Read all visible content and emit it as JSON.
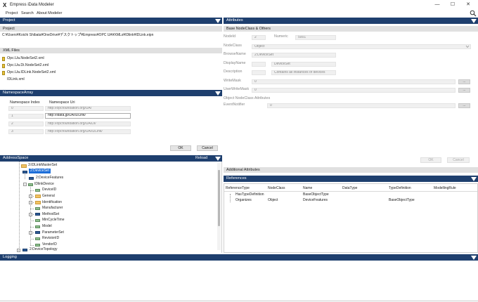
{
  "window": {
    "title": "Empress iData Modeler",
    "logo": "X",
    "controls": {
      "minimize": "—",
      "maximize": "☐",
      "close": "✕"
    }
  },
  "menu": {
    "items": [
      "Project",
      "Search",
      "About Modeler"
    ]
  },
  "project": {
    "header": "Project",
    "subheader": "Project",
    "path": "C:¥Users¥Koichi Shibata¥OneDrive¥デスクトップ¥Empress¥OPC UA¥XMLs¥IDlink¥IDLink.eipn"
  },
  "xml_files": {
    "header": "XML Files",
    "items": [
      "Opc.Ua.NodeSet2.xml",
      "Opc.Ua.Di.NodeSet2.xml",
      "Opc.Ua.IDLink.NodeSet2.xml",
      "IDLink.xml"
    ]
  },
  "namespace": {
    "header": "NamespaceArray",
    "col_index": "Namespace Index",
    "col_uri": "Namespace Uri",
    "rows": [
      {
        "index": "0",
        "uri": "http://opcfoundation.org/UA/"
      },
      {
        "index": "1",
        "uri": "http://idata.jp/UA/IDLink/"
      },
      {
        "index": "2",
        "uri": "http://opcfoundation.org/UA/DI/"
      },
      {
        "index": "3",
        "uri": "http://opcfoundation.org/UA/IDLink/"
      }
    ],
    "ok": "OK",
    "cancel": "Cancel"
  },
  "address_space": {
    "header": "AddressSpace",
    "reload": "Reload",
    "nodes": {
      "idlink_masterset": "3:IDLinkMasterSet",
      "devicenet": "2:DeviceSet",
      "device_features": "2:DeviceFeatures",
      "idlink_device": "IDlinkDevice",
      "device_id": "DeviceID",
      "general": "General",
      "identification": "Identification",
      "manufacturer": "Manufacturer",
      "method_set": "MethodSet",
      "min_cycle_time": "MinCycleTime",
      "model": "Model",
      "parameter_set": "ParameterSet",
      "revision_id": "RevisionID",
      "vendor_id": "VendorID",
      "device_topology": "2:DeviceTopology"
    }
  },
  "attributes": {
    "header": "Attributes",
    "subheader": "Base NodeClass & Others",
    "nodeid_label": "NodeId",
    "nodeid_ns": "2",
    "nodeid_type": "Numeric",
    "nodeid_value": "5001",
    "nodeclass_label": "NodeClass",
    "nodeclass_value": "Object",
    "browsename_label": "BrowseName",
    "browsename_value": "2:DeviceSet",
    "displayname_label": "DisplayName",
    "displayname_value": "DeviceSet",
    "description_label": "Description",
    "description_value": "Contains all instances of devices",
    "writemask_label": "WriteMask",
    "writemask_value": "0",
    "userwritemask_label": "UserWriteMask",
    "userwritemask_value": "0",
    "object_attrs_label": "Object NodeClass Attributes",
    "eventnotifier_label": "EventNotifier",
    "eventnotifier_value": "0",
    "ellipsis": "...",
    "ok": "OK",
    "cancel": "Cancel"
  },
  "additional_attributes": {
    "header": "Additional Attributes"
  },
  "references": {
    "header": "References",
    "columns": [
      "ReferenceType",
      "NodeClass",
      "Name",
      "DataType",
      "TypeDefinition",
      "ModellingRule"
    ],
    "rows": [
      [
        "HasTypeDefinition",
        "",
        "BaseObjectType",
        "",
        "",
        ""
      ],
      [
        "Organizes",
        "Object",
        "DeviceFeatures",
        "",
        "BaseObjectType",
        ""
      ]
    ]
  },
  "logging": {
    "header": "Logging"
  },
  "colors": {
    "header_bg": "#1e3f6e",
    "selection": "#1e6fd9",
    "subheader_bg": "#e0e0e0"
  },
  "icons": {
    "search": "magnifier-icon",
    "collapse": "triangle-down-icon"
  }
}
